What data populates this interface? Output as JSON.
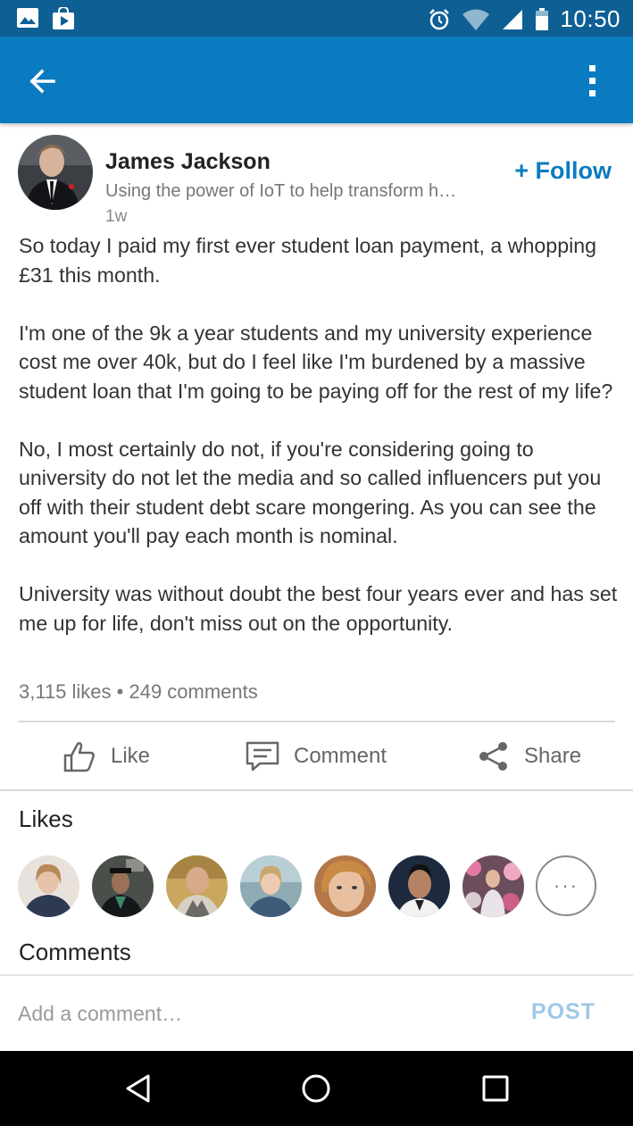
{
  "status_bar": {
    "time": "10:50",
    "icons": [
      "gallery-icon",
      "play-store-icon",
      "alarm-icon",
      "wifi-icon",
      "signal-icon",
      "battery-icon"
    ]
  },
  "app_bar": {
    "back_icon": "back-arrow-icon",
    "menu_icon": "more-vertical-icon"
  },
  "post": {
    "author": {
      "name": "James Jackson",
      "headline": "Using the power of IoT to help transform h…",
      "age": "1w"
    },
    "follow_label": "+ Follow",
    "paragraphs": [
      "So today I paid my first ever student loan payment, a whopping £31 this month.",
      "I'm one of the 9k a year students and my university experience cost me over 40k, but do I feel like I'm burdened by a massive student loan that I'm going to be paying off for the rest of my life?",
      "No, I most certainly do not, if you're considering going to university do not let the media and so called influencers put you off with their student debt scare mongering. As you can see the amount you'll pay each month is nominal.",
      "University was without doubt the best four years ever and has set me up for life, don't miss out on the opportunity."
    ],
    "stats": "3,115 likes • 249 comments"
  },
  "actions": {
    "like": "Like",
    "comment": "Comment",
    "share": "Share"
  },
  "likes": {
    "title": "Likes",
    "more_label": "···"
  },
  "comments": {
    "title": "Comments",
    "input_placeholder": "Add a comment…",
    "post_label": "POST"
  },
  "colors": {
    "status_bar": "#0d5f94",
    "app_bar": "#0a7bc0",
    "accent": "#0a7bc0",
    "post_disabled": "#9ec9e6"
  }
}
